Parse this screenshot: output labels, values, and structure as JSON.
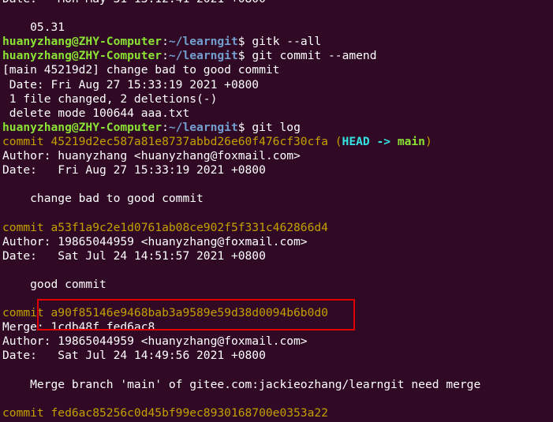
{
  "prompt": {
    "user_host": "huanyzhang@ZHY-Computer",
    "colon": ":",
    "path": "~/learngit",
    "dollar": "$"
  },
  "lines": {
    "l0": "Date:   Mon May 31 13:12:41 2021 +0800",
    "l1": "",
    "l2": "    05.31",
    "l3_cmd": " gitk --all",
    "l4_cmd": " git commit --amend",
    "l5": "[main 45219d2] change bad to good commit",
    "l6": " Date: Fri Aug 27 15:33:19 2021 +0800",
    "l7": " 1 file changed, 2 deletions(-)",
    "l8": " delete mode 100644 aaa.txt",
    "l9_cmd": " git log",
    "l10_commit": "commit 45219d2ec587a81e8737abbd26e60f476cf30cfa",
    "l10_open": " (",
    "l10_head": "HEAD -> ",
    "l10_branch": "main",
    "l10_close": ")",
    "l11": "Author: huanyzhang <huanyzhang@foxmail.com>",
    "l12": "Date:   Fri Aug 27 15:33:19 2021 +0800",
    "l13": "",
    "l14": "    change bad to good commit",
    "l15": "",
    "l16_commit": "commit a53f1a9c2e1d0761ab08ce902f5f331c462866d4",
    "l17": "Author: 19865044959 <huanyzhang@foxmail.com>",
    "l18": "Date:   Sat Jul 24 14:51:57 2021 +0800",
    "l19": "",
    "l20": "    good commit",
    "l21": "",
    "l22_commit": "commit a90f85146e9468bab3a9589e59d38d0094b6b0d0",
    "l23": "Merge: 1cdb48f fed6ac8",
    "l24": "Author: 19865044959 <huanyzhang@foxmail.com>",
    "l25": "Date:   Sat Jul 24 14:49:56 2021 +0800",
    "l26": "",
    "l27": "    Merge branch 'main' of gitee.com:jackieozhang/learngit need merge",
    "l28": "",
    "l29_commit": "commit fed6ac85256c0d45bf99ec8930168700e0353a22"
  },
  "colors": {
    "background": "#300a24",
    "prompt_user": "#8ae234",
    "prompt_path": "#729fcf",
    "commit_hash": "#c4a000",
    "head_ref": "#34e2e2",
    "annotation_box": "#e00000"
  }
}
